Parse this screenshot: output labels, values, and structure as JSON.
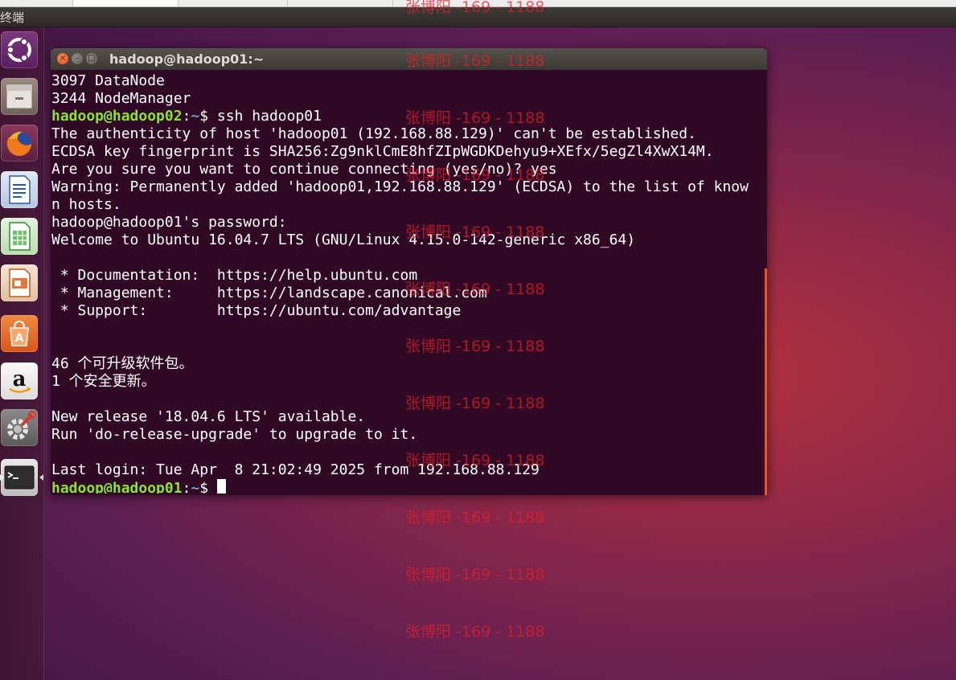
{
  "panel": {
    "title": "终端"
  },
  "launcher": {
    "items": [
      {
        "name": "Dash",
        "icon": "ubuntu-dash-icon"
      },
      {
        "name": "Files",
        "icon": "files-icon"
      },
      {
        "name": "Firefox",
        "icon": "firefox-icon"
      },
      {
        "name": "LibreOffice Writer",
        "icon": "writer-icon"
      },
      {
        "name": "LibreOffice Calc",
        "icon": "calc-icon"
      },
      {
        "name": "LibreOffice Impress",
        "icon": "impress-icon"
      },
      {
        "name": "Ubuntu Software",
        "icon": "software-center-icon"
      },
      {
        "name": "Amazon",
        "icon": "amazon-icon",
        "glyph": "a"
      },
      {
        "name": "System Settings",
        "icon": "settings-icon"
      },
      {
        "name": "Terminal",
        "icon": "terminal-icon",
        "glyph": ">_"
      }
    ]
  },
  "window": {
    "title": "hadoop@hadoop01:~",
    "buttons": {
      "close": "×",
      "minimize": "–",
      "maximize": "□"
    }
  },
  "terminal": {
    "lines": [
      {
        "text": "3097 DataNode"
      },
      {
        "text": "3244 NodeManager"
      },
      {
        "user": "hadoop@hadoop02",
        "sep": ":",
        "path": "~",
        "cmd": "$ ssh hadoop01"
      },
      {
        "text": "The authenticity of host 'hadoop01 (192.168.88.129)' can't be established."
      },
      {
        "text": "ECDSA key fingerprint is SHA256:Zg9nklCmE8hfZIpWGDKDehyu9+XEfx/5egZl4XwX14M."
      },
      {
        "text": "Are you sure you want to continue connecting (yes/no)? yes"
      },
      {
        "text": "Warning: Permanently added 'hadoop01,192.168.88.129' (ECDSA) to the list of know"
      },
      {
        "text": "n hosts."
      },
      {
        "text": "hadoop@hadoop01's password:"
      },
      {
        "text": "Welcome to Ubuntu 16.04.7 LTS (GNU/Linux 4.15.0-142-generic x86_64)"
      },
      {
        "text": ""
      },
      {
        "text": " * Documentation:  https://help.ubuntu.com"
      },
      {
        "text": " * Management:     https://landscape.canonical.com"
      },
      {
        "text": " * Support:        https://ubuntu.com/advantage"
      },
      {
        "text": ""
      },
      {
        "text": ""
      },
      {
        "text": "46 个可升级软件包。"
      },
      {
        "text": "1 个安全更新。"
      },
      {
        "text": ""
      },
      {
        "text": "New release '18.04.6 LTS' available."
      },
      {
        "text": "Run 'do-release-upgrade' to upgrade to it."
      },
      {
        "text": ""
      },
      {
        "text": "Last login: Tue Apr  8 21:02:49 2025 from 192.168.88.129"
      }
    ],
    "prompt": {
      "user": "hadoop@hadoop01",
      "sep": ":",
      "path": "~",
      "cmd": "$ "
    }
  },
  "watermark": {
    "text": "张博阳 -169 - 1188"
  }
}
